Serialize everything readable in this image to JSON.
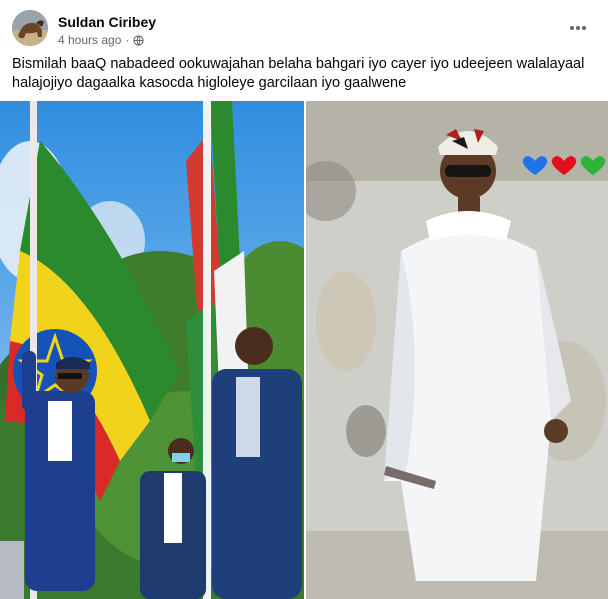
{
  "post": {
    "author": "Suldan Ciribey",
    "time": "4 hours ago",
    "separator": "·",
    "caption": "Bismilah baaQ nabadeed ookuwajahan belaha bahgari iyo cayer iyo udeejeen  walalayaal halajojiyo dagaalka kasocda higloleye garcilaan  iyo gaalwene"
  },
  "icons": {
    "privacy": "globe-icon",
    "more": "more-options-icon",
    "hearts": [
      "blue-heart-icon",
      "red-heart-icon",
      "green-heart-icon"
    ]
  },
  "colors": {
    "author_text": "#050505",
    "meta_text": "#65676b",
    "heart_blue": "#1e73e8",
    "heart_red": "#e3101c",
    "heart_green": "#2bb33a"
  }
}
